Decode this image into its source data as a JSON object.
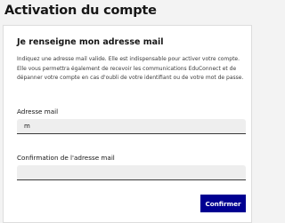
{
  "page": {
    "title": "Activation du compte"
  },
  "section": {
    "title": "Je renseigne mon adresse mail",
    "description": "Indiquez une adresse mail valide. Elle est indispensable pour activer votre compte. Elle vous permettra également de recevoir les communications EduConnect et de dépanner votre compte en cas d'oubli de votre identifiant ou de votre mot de passe."
  },
  "form": {
    "email": {
      "label": "Adresse mail",
      "value": "m"
    },
    "email_confirm": {
      "label": "Confirmation de l'adresse mail",
      "value": ""
    },
    "submit_label": "Confirmer"
  },
  "colors": {
    "primary": "#000091",
    "input_background": "#eeeeee",
    "page_background": "#f3f3f3"
  }
}
